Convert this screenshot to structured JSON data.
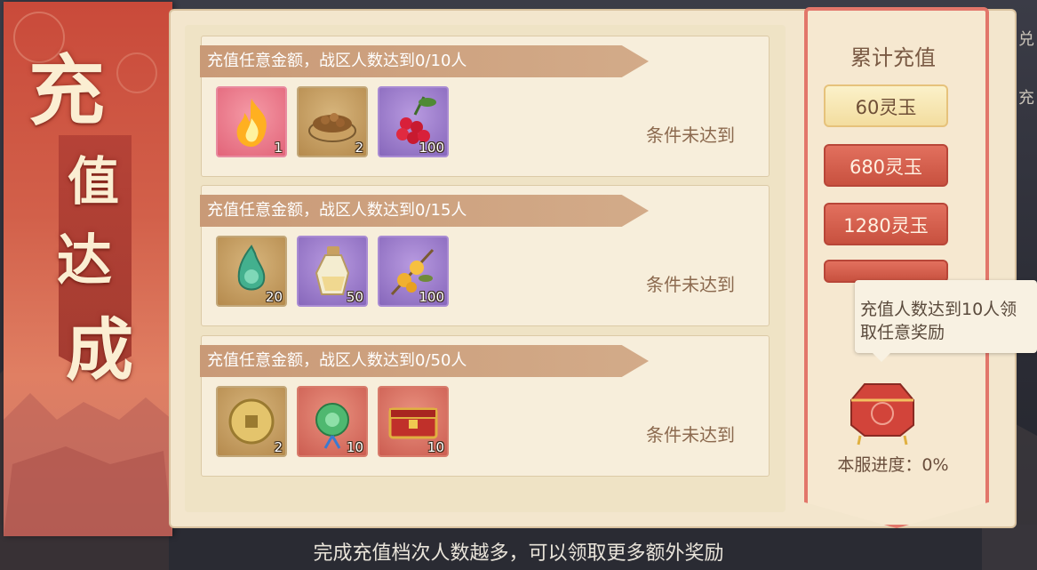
{
  "banner": {
    "title_chars": [
      "充",
      "值",
      "达",
      "成"
    ]
  },
  "tiers": [
    {
      "header": "充值任意金额，战区人数达到0/10人",
      "status": "条件未达到",
      "items": [
        {
          "icon": "flame-icon",
          "count": "1",
          "frame": "pink"
        },
        {
          "icon": "pet-food-bowl-icon",
          "count": "2",
          "frame": "gold"
        },
        {
          "icon": "red-berries-icon",
          "count": "100",
          "frame": "purple"
        }
      ]
    },
    {
      "header": "充值任意金额，战区人数达到0/15人",
      "status": "条件未达到",
      "items": [
        {
          "icon": "jade-pendant-icon",
          "count": "20",
          "frame": "gold"
        },
        {
          "icon": "potion-bottle-icon",
          "count": "50",
          "frame": "purple"
        },
        {
          "icon": "golden-flower-icon",
          "count": "100",
          "frame": "purple"
        }
      ]
    },
    {
      "header": "充值任意金额，战区人数达到0/50人",
      "status": "条件未达到",
      "items": [
        {
          "icon": "gold-coin-icon",
          "count": "2",
          "frame": "gold"
        },
        {
          "icon": "jade-ornament-icon",
          "count": "10",
          "frame": "red"
        },
        {
          "icon": "red-chest-icon",
          "count": "10",
          "frame": "red"
        }
      ]
    }
  ],
  "recharge": {
    "title": "累计充值",
    "options": [
      {
        "label": "60灵玉",
        "selected": true
      },
      {
        "label": "680灵玉",
        "selected": false
      },
      {
        "label": "1280灵玉",
        "selected": false
      }
    ]
  },
  "tooltip": {
    "text_line1": "充值人数达到10人领",
    "text_line2": "取任意奖励"
  },
  "server_progress": {
    "label": "本服进度：",
    "value": "0%"
  },
  "footer": {
    "hint": "完成充值档次人数越多，可以领取更多额外奖励"
  },
  "side_tab": {
    "chars": [
      "兑",
      "充"
    ]
  },
  "colors": {
    "accent_red": "#d2604a",
    "panel_bg": "#f3e6cd",
    "header_tan": "#c99a77"
  }
}
